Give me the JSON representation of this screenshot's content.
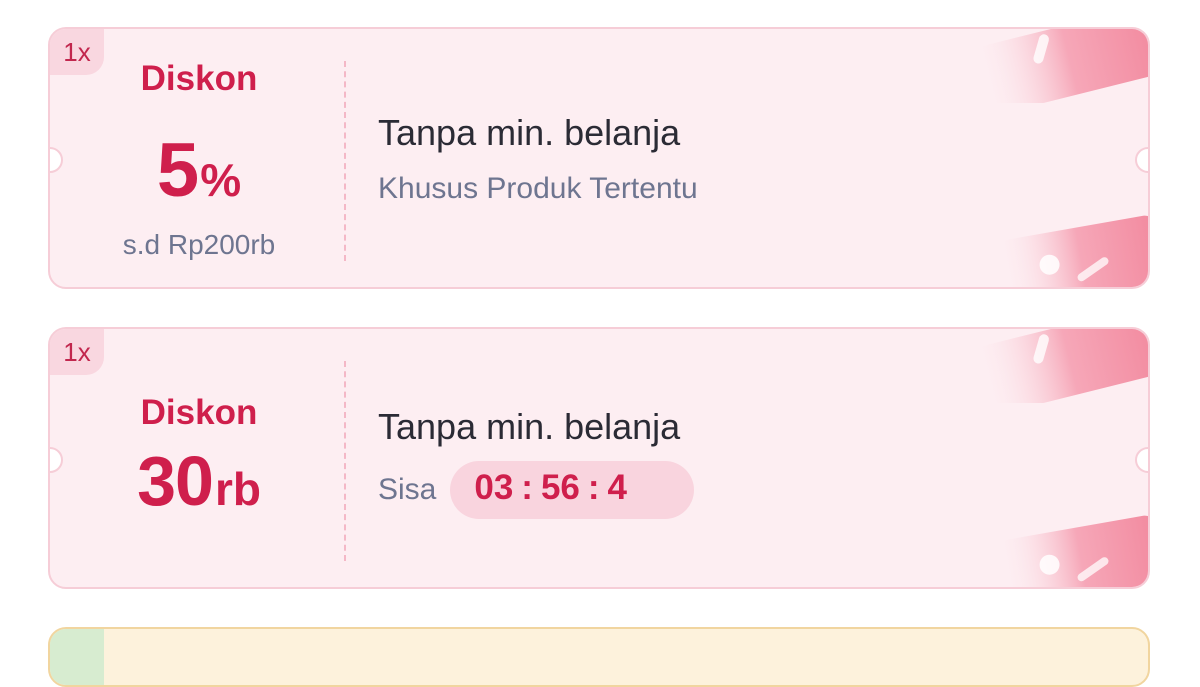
{
  "colors": {
    "accent": "#cf1f4c",
    "card_background": "#fdeef2",
    "card_border": "#f6cdd7",
    "muted_text": "#6e7590",
    "title_text": "#2b2b35"
  },
  "vouchers": [
    {
      "usage_badge": "1x",
      "label": "Diskon",
      "amount_value": "5",
      "amount_unit": "%",
      "cap": "s.d Rp200rb",
      "title": "Tanpa min. belanja",
      "subtitle": "Khusus Produk Tertentu"
    },
    {
      "usage_badge": "1x",
      "label": "Diskon",
      "amount_value": "30",
      "amount_unit": "rb",
      "title": "Tanpa min. belanja",
      "timer_label": "Sisa",
      "timer": {
        "hours": "03",
        "minutes": "56",
        "seconds": "4",
        "separator": ":"
      }
    }
  ],
  "icons": {
    "decoration": "ticket-decoration-icon"
  }
}
